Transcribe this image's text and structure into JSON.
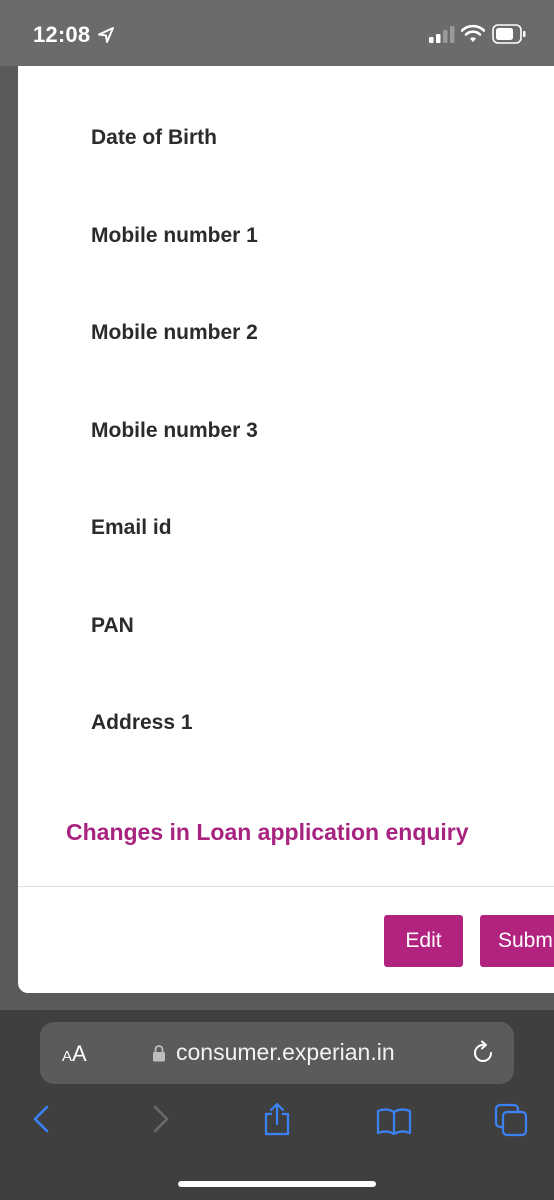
{
  "status_bar": {
    "time": "12:08",
    "icons": [
      "location-arrow-icon",
      "cellular-signal-icon",
      "wifi-icon",
      "battery-icon"
    ]
  },
  "form": {
    "fields": [
      {
        "label": "Date of Birth"
      },
      {
        "label": "Mobile number 1"
      },
      {
        "label": "Mobile number 2"
      },
      {
        "label": "Mobile number 3"
      },
      {
        "label": "Email id"
      },
      {
        "label": "PAN"
      },
      {
        "label": "Address 1"
      }
    ],
    "section_title": "Changes in Loan application enquiry",
    "buttons": {
      "edit": "Edit",
      "submit": "Subm"
    }
  },
  "browser": {
    "text_size_label_small": "A",
    "text_size_label_large": "A",
    "url": "consumer.experian.in",
    "toolbar_icons": [
      "back-icon",
      "forward-icon",
      "share-icon",
      "bookmarks-icon",
      "tabs-icon"
    ]
  },
  "colors": {
    "accent": "#b1237f",
    "toolbar_icon": "#3b82f6"
  }
}
